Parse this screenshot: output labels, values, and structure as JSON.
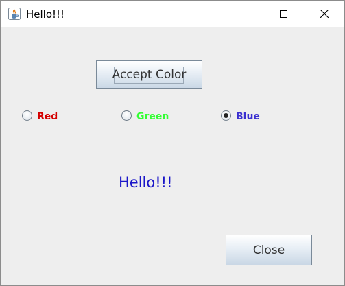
{
  "window": {
    "title": "Hello!!!",
    "app_icon": "java-cup-icon"
  },
  "controls": {
    "minimize_icon": "minimize-icon",
    "maximize_icon": "maximize-icon",
    "close_icon": "close-icon"
  },
  "buttons": {
    "accept_label": "Accept Color",
    "close_label": "Close"
  },
  "radios": [
    {
      "label": "Red",
      "color": "#d40000",
      "checked": false
    },
    {
      "label": "Green",
      "color": "#33ff33",
      "checked": false
    },
    {
      "label": "Blue",
      "color": "#3a2fd0",
      "checked": true
    }
  ],
  "message": {
    "text": "Hello!!!",
    "color": "#1a16c8"
  }
}
